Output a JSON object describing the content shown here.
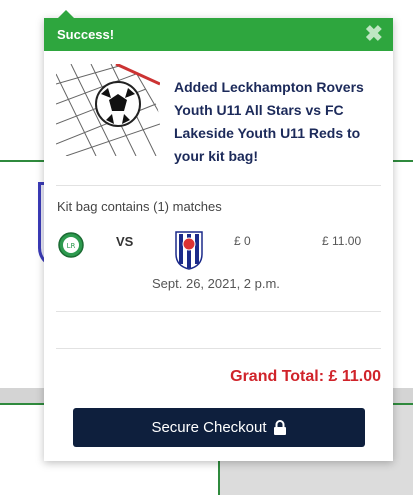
{
  "popup": {
    "header_title": "Success!",
    "close_icon": "close-icon",
    "message": "Added Leckhampton Rovers Youth U11 All Stars vs FC Lakeside Youth U11 Reds to your kit bag!",
    "kit_bag_count": "Kit bag contains (1) matches",
    "match": {
      "vs": "VS",
      "price_a": "£ 0",
      "price_b": "£ 11.00",
      "date": "Sept. 26, 2021, 2 p.m."
    },
    "grand_total": "Grand Total: £ 11.00",
    "checkout_label": "Secure Checkout",
    "colors": {
      "header_green": "#2ea63e",
      "title_navy": "#1c2a5a",
      "total_red": "#d0232a",
      "button_navy": "#0e1f3d"
    }
  }
}
